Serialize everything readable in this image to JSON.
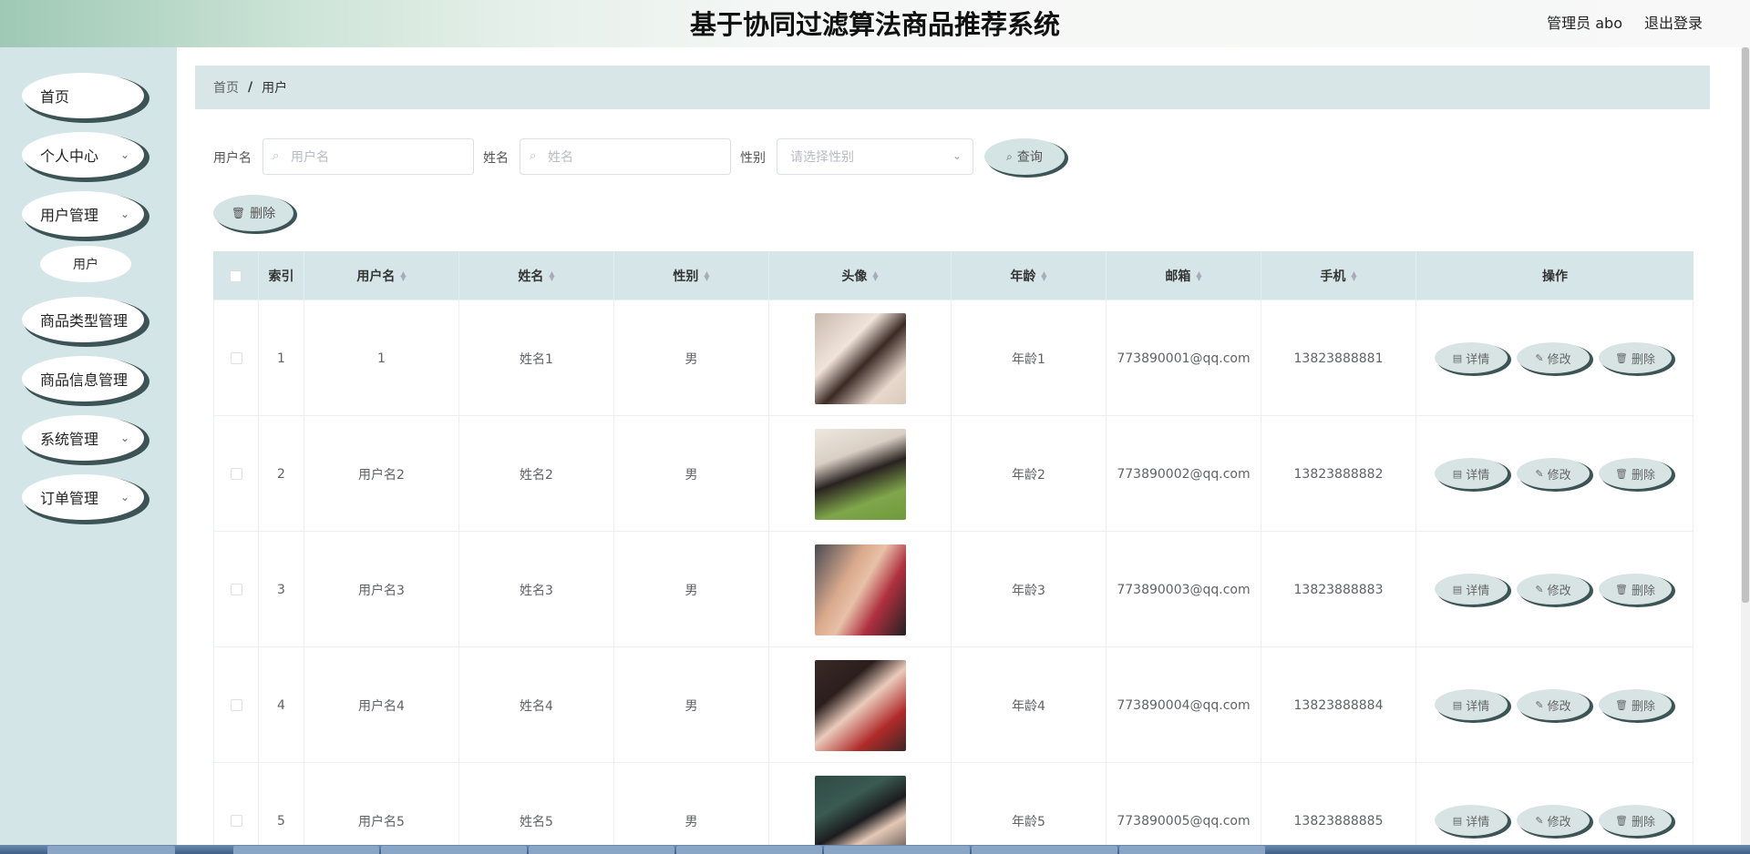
{
  "header": {
    "title": "基于协同过滤算法商品推荐系统",
    "user": "管理员 abo",
    "logout": "退出登录"
  },
  "sidebar": {
    "items": [
      {
        "label": "首页",
        "has_children": false
      },
      {
        "label": "个人中心",
        "has_children": true
      },
      {
        "label": "用户管理",
        "has_children": true
      },
      {
        "label": "商品类型管理",
        "has_children": false
      },
      {
        "label": "商品信息管理",
        "has_children": false
      },
      {
        "label": "系统管理",
        "has_children": true
      },
      {
        "label": "订单管理",
        "has_children": true
      }
    ],
    "sub_item": "用户"
  },
  "breadcrumb": {
    "home": "首页",
    "separator": "/",
    "current": "用户"
  },
  "search": {
    "username_label": "用户名",
    "username_placeholder": "用户名",
    "name_label": "姓名",
    "name_placeholder": "姓名",
    "gender_label": "性别",
    "gender_placeholder": "请选择性别",
    "query_button": "查询"
  },
  "toolbar": {
    "delete_button": "删除"
  },
  "table": {
    "columns": [
      "索引",
      "用户名",
      "姓名",
      "性别",
      "头像",
      "年龄",
      "邮箱",
      "手机",
      "操作"
    ],
    "rows": [
      {
        "index": "1",
        "username": "1",
        "name": "姓名1",
        "gender": "男",
        "age": "年龄1",
        "email": "773890001@qq.com",
        "phone": "13823888881"
      },
      {
        "index": "2",
        "username": "用户名2",
        "name": "姓名2",
        "gender": "男",
        "age": "年龄2",
        "email": "773890002@qq.com",
        "phone": "13823888882"
      },
      {
        "index": "3",
        "username": "用户名3",
        "name": "姓名3",
        "gender": "男",
        "age": "年龄3",
        "email": "773890003@qq.com",
        "phone": "13823888883"
      },
      {
        "index": "4",
        "username": "用户名4",
        "name": "姓名4",
        "gender": "男",
        "age": "年龄4",
        "email": "773890004@qq.com",
        "phone": "13823888884"
      },
      {
        "index": "5",
        "username": "用户名5",
        "name": "姓名5",
        "gender": "男",
        "age": "年龄5",
        "email": "773890005@qq.com",
        "phone": "13823888885"
      }
    ],
    "actions": {
      "detail": "详情",
      "edit": "修改",
      "delete": "删除"
    }
  },
  "colors": {
    "sidebar_bg": "#d4e5e7",
    "header_accent": "#9fc9b4",
    "button_bg": "#d4e3e3",
    "button_shadow": "#3d5456"
  }
}
